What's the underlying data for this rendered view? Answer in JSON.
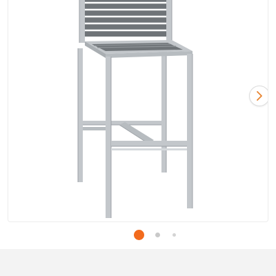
{
  "product_gallery": {
    "image_subject": "bar stool",
    "next_icon": "chevron-right-icon",
    "pager": {
      "total_pages": 3,
      "current_page": 1,
      "active_color": "#f26b1d",
      "inactive_color": "#c9c9c9",
      "far_color": "#d4d4d4"
    }
  },
  "colors": {
    "frame_metal": "#c3c7cb",
    "frame_metal_shadow": "#9da2a7",
    "slats": "#6f7478",
    "bottom_bar": "#f3f3f3"
  }
}
